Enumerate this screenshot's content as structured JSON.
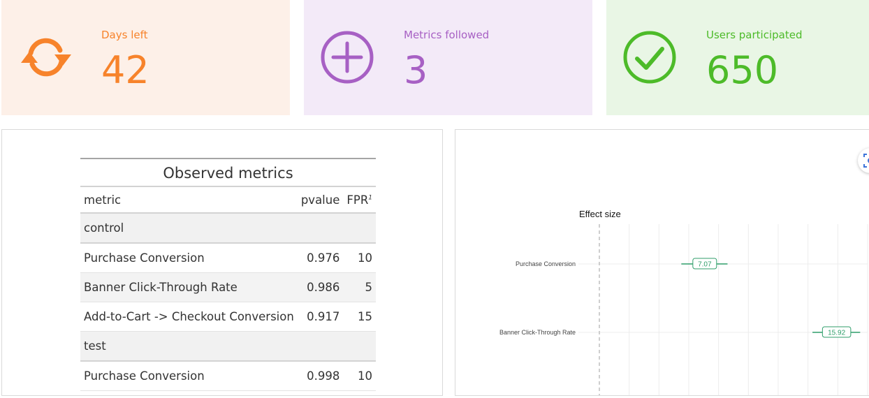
{
  "cards": {
    "days": {
      "label": "Days left",
      "value": "42",
      "icon": "refresh-icon",
      "color": "#f7832b"
    },
    "metrics": {
      "label": "Metrics followed",
      "value": "3",
      "icon": "plus-circle-icon",
      "color": "#a760c4"
    },
    "users": {
      "label": "Users participated",
      "value": "650",
      "icon": "check-circle-icon",
      "color": "#4dbb29"
    }
  },
  "table": {
    "title": "Observed metrics",
    "headers": {
      "metric": "metric",
      "pvalue": "pvalue",
      "fpr": "FPR",
      "fpr_mark": "1"
    },
    "groups": [
      {
        "name": "control"
      },
      {
        "name": "test"
      }
    ],
    "rows": [
      {
        "metric": "Purchase Conversion",
        "pvalue": "0.976",
        "fpr": "10"
      },
      {
        "metric": "Banner Click-Through Rate",
        "pvalue": "0.986",
        "fpr": "5"
      },
      {
        "metric": "Add-to-Cart -> Checkout Conversion",
        "pvalue": "0.917",
        "fpr": "15"
      },
      {
        "metric": "Purchase Conversion",
        "pvalue": "0.998",
        "fpr": "10"
      }
    ]
  },
  "chart_data": {
    "type": "scatter",
    "title": "Effect size",
    "categories": [
      "Purchase Conversion",
      "Banner Click-Through Rate"
    ],
    "series": [
      {
        "points": [
          {
            "category": "Purchase Conversion",
            "value": 7.07,
            "label": "7.07",
            "low": 5.5,
            "high": 8.6
          },
          {
            "category": "Banner Click-Through Rate",
            "value": 15.92,
            "label": "15.92",
            "low": 14.3,
            "high": 17.5
          }
        ]
      }
    ],
    "reference_line": 0,
    "grid": true,
    "color": "#2f9e6a"
  }
}
